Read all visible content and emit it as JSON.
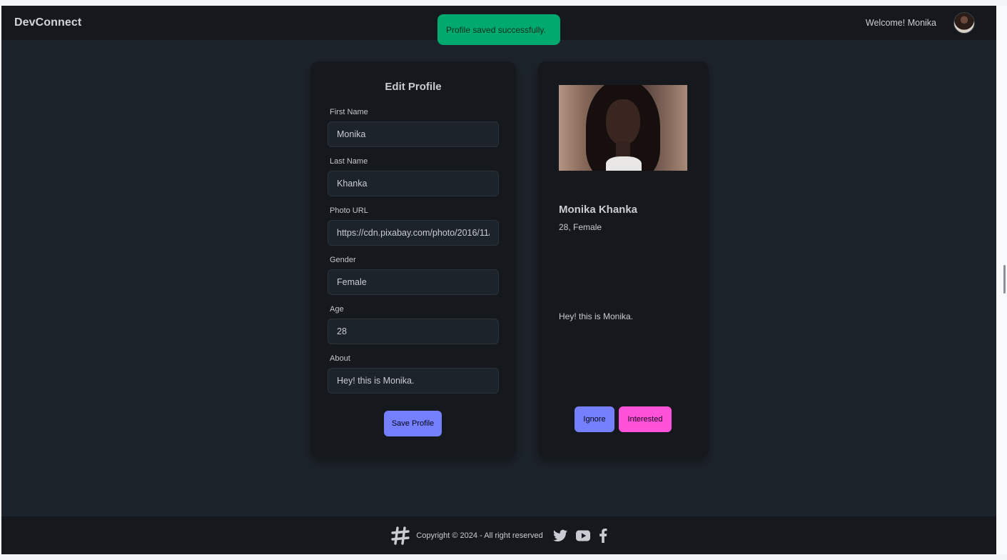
{
  "navbar": {
    "brand": "DevConnect",
    "welcome": "Welcome! Monika",
    "avatar_icon": "user-avatar"
  },
  "toast": {
    "message": "Profile saved successfully.",
    "color": "#00a96e"
  },
  "edit_profile": {
    "title": "Edit Profile",
    "fields": {
      "first_name": {
        "label": "First Name",
        "value": "Monika"
      },
      "last_name": {
        "label": "Last Name",
        "value": "Khanka"
      },
      "photo_url": {
        "label": "Photo URL",
        "value": "https://cdn.pixabay.com/photo/2016/11/"
      },
      "gender": {
        "label": "Gender",
        "value": "Female"
      },
      "age": {
        "label": "Age",
        "value": "28"
      },
      "about": {
        "label": "About",
        "value": "Hey! this is Monika."
      }
    },
    "save_label": "Save Profile"
  },
  "preview": {
    "name": "Monika Khanka",
    "meta": "28, Female",
    "about": "Hey! this is Monika.",
    "ignore_label": "Ignore",
    "interested_label": "Interested"
  },
  "footer": {
    "copyright": "Copyright © 2024 - All right reserved",
    "icons": [
      "logo-icon",
      "twitter-icon",
      "youtube-icon",
      "facebook-icon"
    ]
  },
  "colors": {
    "background": "#1d232a",
    "card": "#15191e",
    "primary": "#7480ff",
    "secondary": "#ff52d9",
    "success": "#00a96e"
  }
}
